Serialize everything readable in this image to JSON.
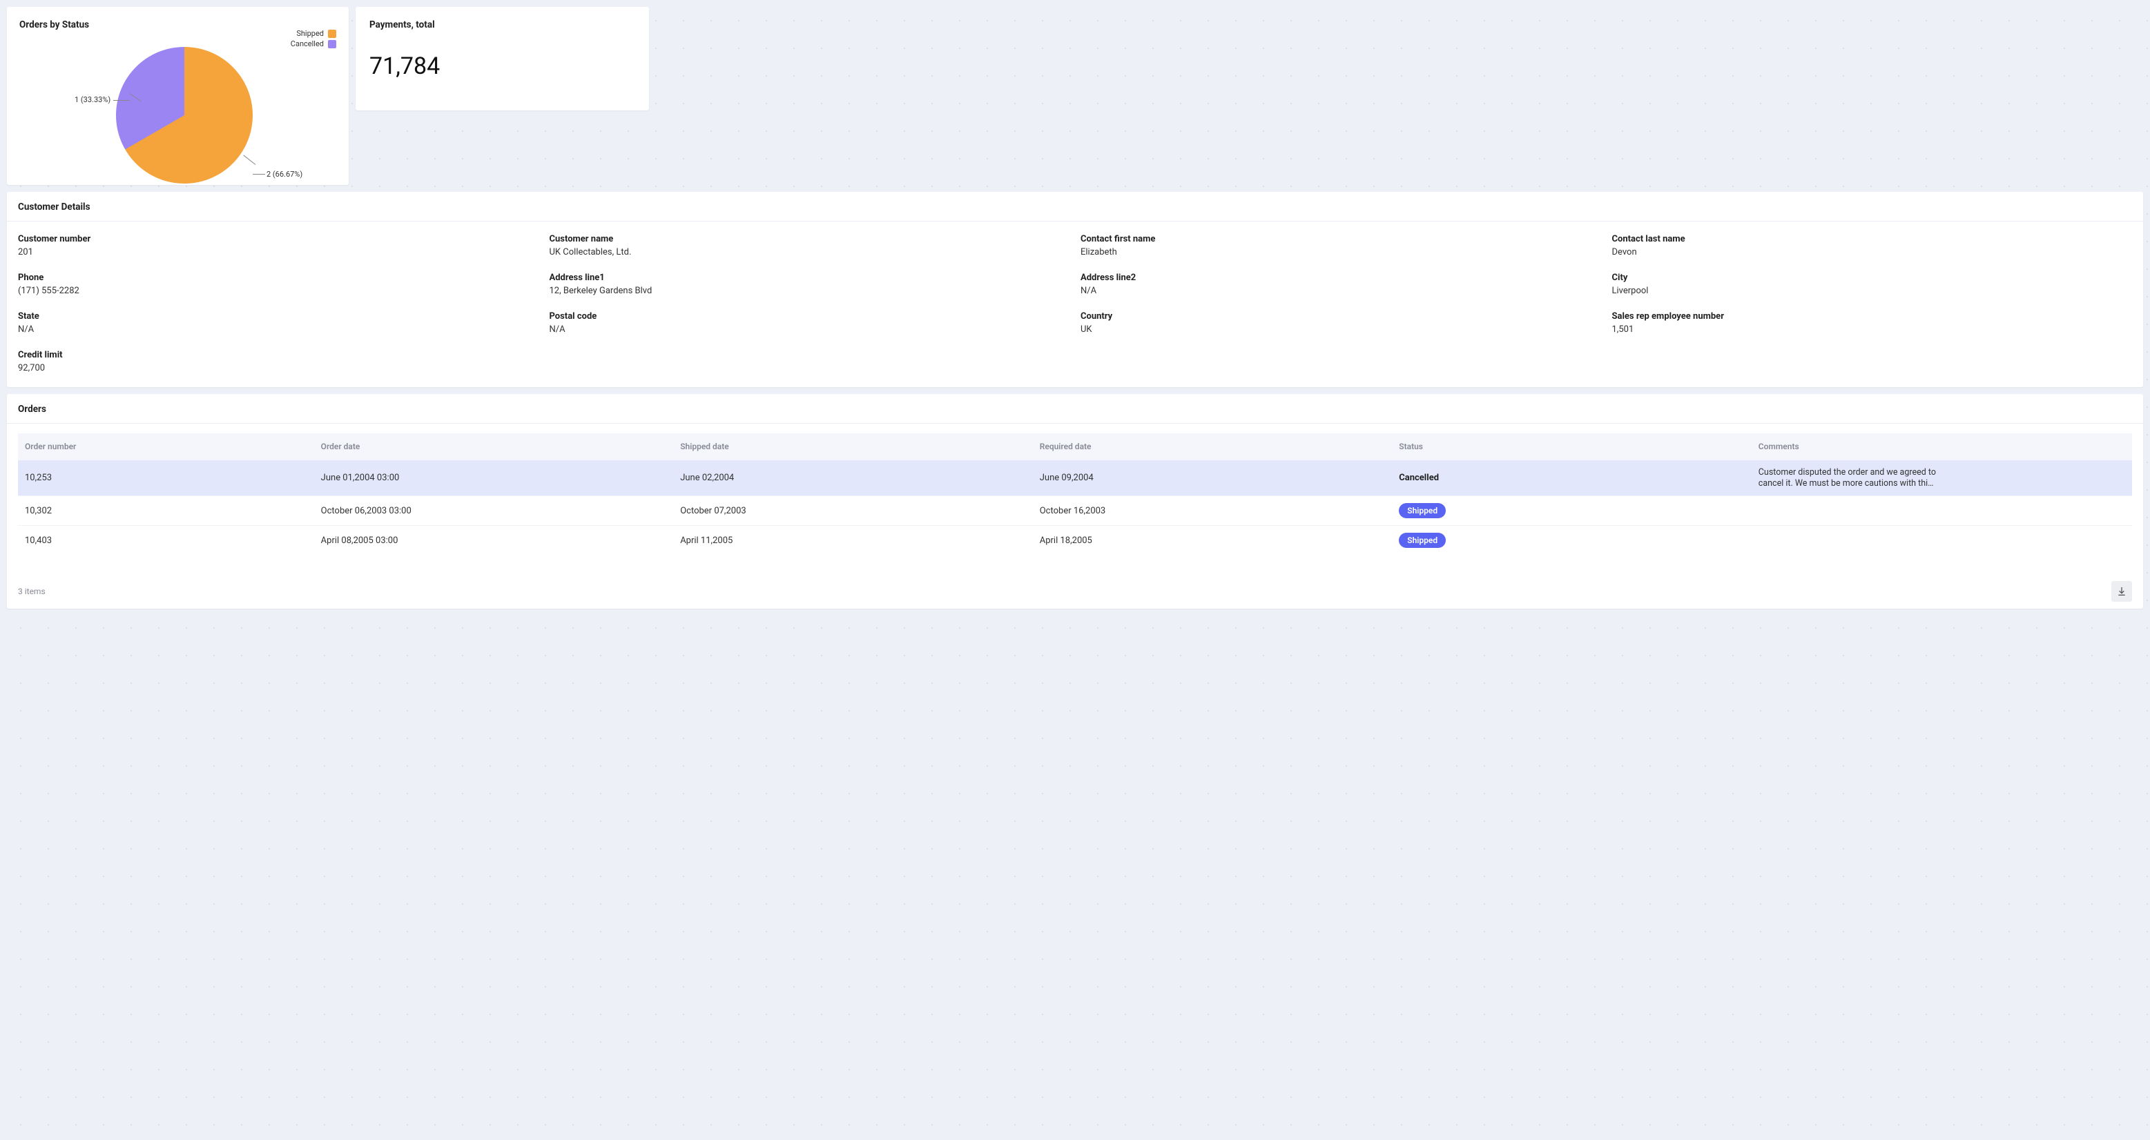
{
  "pie": {
    "title": "Orders by Status",
    "legend": [
      {
        "label": "Shipped",
        "color": "#f5a33b"
      },
      {
        "label": "Cancelled",
        "color": "#9a85f3"
      }
    ],
    "labels": {
      "cancelled": "1 (33.33%)",
      "shipped": "2 (66.67%)"
    }
  },
  "kpi": {
    "title": "Payments, total",
    "value": "71,784"
  },
  "customer": {
    "panel_title": "Customer Details",
    "fields": [
      {
        "label": "Customer number",
        "value": "201"
      },
      {
        "label": "Customer name",
        "value": "UK Collectables, Ltd."
      },
      {
        "label": "Contact first name",
        "value": "Elizabeth"
      },
      {
        "label": "Contact last name",
        "value": "Devon"
      },
      {
        "label": "Phone",
        "value": "(171) 555-2282"
      },
      {
        "label": "Address line1",
        "value": "12, Berkeley Gardens Blvd"
      },
      {
        "label": "Address line2",
        "value": "N/A"
      },
      {
        "label": "City",
        "value": "Liverpool"
      },
      {
        "label": "State",
        "value": "N/A"
      },
      {
        "label": "Postal code",
        "value": "N/A"
      },
      {
        "label": "Country",
        "value": "UK"
      },
      {
        "label": "Sales rep employee number",
        "value": "1,501"
      },
      {
        "label": "Credit limit",
        "value": "92,700"
      }
    ]
  },
  "orders": {
    "panel_title": "Orders",
    "columns": [
      "Order number",
      "Order date",
      "Shipped date",
      "Required date",
      "Status",
      "Comments"
    ],
    "rows": [
      {
        "order_number": "10,253",
        "order_date": "June 01,2004 03:00",
        "shipped_date": "June 02,2004",
        "required_date": "June 09,2004",
        "status": "Cancelled",
        "status_style": "text",
        "comments": "Customer disputed the order and we agreed to cancel it. We must be more cautions with this …",
        "selected": true
      },
      {
        "order_number": "10,302",
        "order_date": "October 06,2003 03:00",
        "shipped_date": "October 07,2003",
        "required_date": "October 16,2003",
        "status": "Shipped",
        "status_style": "pill",
        "comments": "",
        "selected": false
      },
      {
        "order_number": "10,403",
        "order_date": "April 08,2005 03:00",
        "shipped_date": "April 11,2005",
        "required_date": "April 18,2005",
        "status": "Shipped",
        "status_style": "pill",
        "comments": "",
        "selected": false
      }
    ],
    "footer_count": "3 items"
  },
  "chart_data": {
    "type": "pie",
    "title": "Orders by Status",
    "series": [
      {
        "name": "Shipped",
        "value": 2,
        "percent": 66.67,
        "color": "#f5a33b"
      },
      {
        "name": "Cancelled",
        "value": 1,
        "percent": 33.33,
        "color": "#9a85f3"
      }
    ]
  }
}
